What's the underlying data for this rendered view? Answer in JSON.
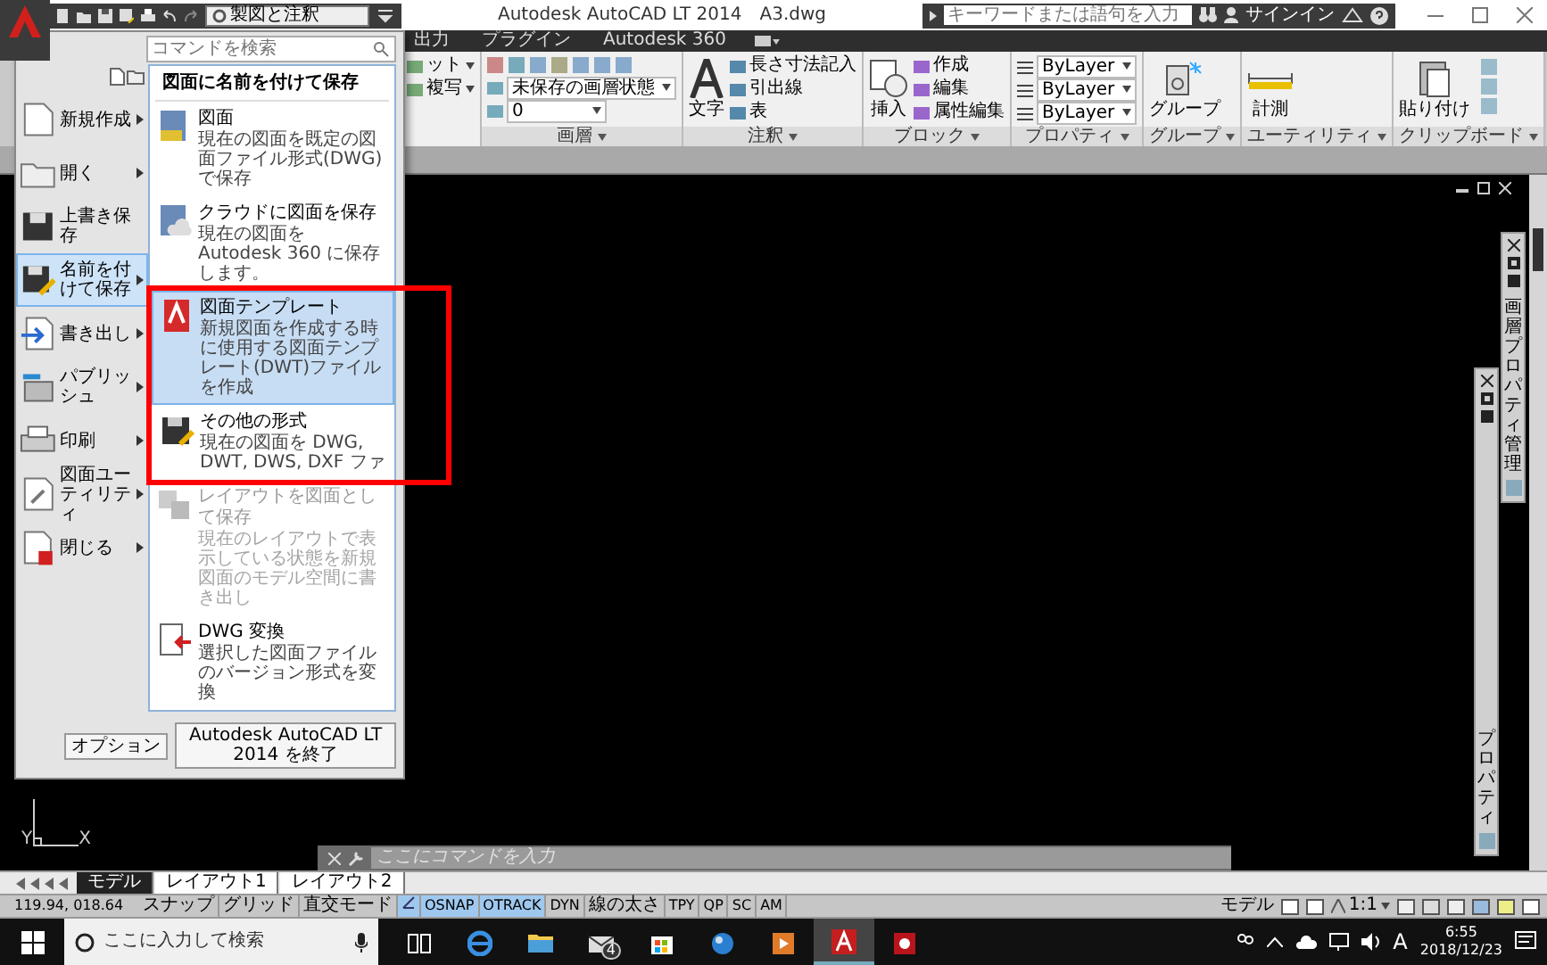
{
  "title_bar": {
    "workspace": "製図と注釈",
    "title": "Autodesk AutoCAD LT 2014",
    "file": "A3.dwg",
    "search": {
      "placeholder": "キーワードまたは語句を入力"
    },
    "sign_in": "サインイン"
  },
  "ribbon_tabs": [
    {
      "label": "出力",
      "selected": false
    },
    {
      "label": "プラグイン",
      "selected": false
    },
    {
      "label": "Autodesk 360",
      "selected": false
    }
  ],
  "ribbon_panels": [
    {
      "kind": "partial",
      "rows": [
        {
          "kind": "button",
          "label": "ット"
        },
        {
          "kind": "button",
          "label": "複写"
        }
      ]
    },
    {
      "kind": "layer",
      "title": "画層",
      "rows": [
        {
          "kind": "dropdown",
          "label": "未保存の画層状態"
        },
        {
          "kind": "dropdown",
          "label": "0"
        }
      ]
    },
    {
      "kind": "annotation",
      "title": "注釈",
      "large": "文字",
      "rows": [
        {
          "kind": "button",
          "label": "長さ寸法記入"
        },
        {
          "kind": "button",
          "label": "引出線"
        },
        {
          "kind": "button",
          "label": "表"
        }
      ]
    },
    {
      "kind": "block",
      "title": "ブロック",
      "large": "挿入",
      "rows": [
        {
          "kind": "button",
          "label": "作成"
        },
        {
          "kind": "button",
          "label": "編集"
        },
        {
          "kind": "button",
          "label": "属性編集"
        }
      ]
    },
    {
      "kind": "properties",
      "title": "プロパティ",
      "rows": [
        {
          "kind": "dropdown",
          "label": "ByLayer"
        },
        {
          "kind": "dropdown",
          "label": "ByLayer"
        },
        {
          "kind": "dropdown",
          "label": "ByLayer"
        }
      ]
    },
    {
      "kind": "group",
      "title": "グループ",
      "large": "グループ"
    },
    {
      "kind": "utilities",
      "title": "ユーティリティ",
      "large": "計測"
    },
    {
      "kind": "clipboard",
      "title": "クリップボード",
      "large": "貼り付け"
    }
  ],
  "app_menu": {
    "search": {
      "placeholder": "コマンドを検索"
    },
    "left_items": [
      {
        "kind": "new",
        "label": "新規作成",
        "submenu": true,
        "selected": false
      },
      {
        "kind": "open",
        "label": "開く",
        "submenu": true,
        "selected": false
      },
      {
        "kind": "save",
        "label": "上書き保存",
        "submenu": false,
        "selected": false
      },
      {
        "kind": "saveas",
        "label": "名前を付けて保存",
        "submenu": true,
        "selected": true
      },
      {
        "kind": "export",
        "label": "書き出し",
        "submenu": true,
        "selected": false
      },
      {
        "kind": "publish",
        "label": "パブリッシュ",
        "submenu": true,
        "selected": false
      },
      {
        "kind": "print",
        "label": "印刷",
        "submenu": true,
        "selected": false
      },
      {
        "kind": "utilities",
        "label": "図面ユーティリティ",
        "submenu": true,
        "selected": false
      },
      {
        "kind": "close",
        "label": "閉じる",
        "submenu": true,
        "selected": false
      }
    ],
    "panel_title": "図面に名前を付けて保存",
    "panel_items": [
      {
        "kind": "drawing",
        "title": "図面",
        "description": "現在の図面を既定の図面ファイル形式(DWG)で保存",
        "selected": false,
        "disabled": false,
        "framed": false
      },
      {
        "kind": "cloud",
        "title": "クラウドに図面を保存",
        "description": "現在の図面を Autodesk 360 に保存します。",
        "selected": false,
        "disabled": false,
        "framed": false
      },
      {
        "kind": "template",
        "title": "図面テンプレート",
        "description": "新規図面を作成する時に使用する図面テンプレート(DWT)ファイルを作成",
        "selected": true,
        "disabled": false,
        "framed": true
      },
      {
        "kind": "other",
        "title": "その他の形式",
        "description": "現在の図面を DWG, DWT, DWS, DXF ファ",
        "selected": false,
        "disabled": false,
        "framed": true
      },
      {
        "kind": "layout",
        "title": "レイアウトを図面として保存",
        "description": "現在のレイアウトで表示している状態を新規図面のモデル空間に書き出し",
        "selected": false,
        "disabled": true,
        "framed": false
      },
      {
        "kind": "convert",
        "title": "DWG 変換",
        "description": "選択した図面ファイルのバージョン形式を変換",
        "selected": false,
        "disabled": false,
        "framed": false
      }
    ],
    "buttons": [
      "オプション",
      "Autodesk AutoCAD LT 2014 を終了"
    ]
  },
  "drawing": {
    "ucs": {
      "x": "X",
      "y": "Y"
    },
    "palettes": [
      {
        "title": "画層プロパティ管理"
      },
      {
        "title": "プロパティ"
      }
    ],
    "command_line": {
      "placeholder": "ここにコマンドを入力"
    }
  },
  "layout_tabs": [
    {
      "label": "モデル",
      "selected": true
    },
    {
      "label": "レイアウト1",
      "selected": false
    },
    {
      "label": "レイアウト2",
      "selected": false
    }
  ],
  "status_bar": {
    "coordinates": "119.94, 018.64",
    "toggles": [
      {
        "kind": "text",
        "label": "スナップ",
        "on": false
      },
      {
        "kind": "text",
        "label": "グリッド",
        "on": false
      },
      {
        "kind": "text",
        "label": "直交モード",
        "on": false
      },
      {
        "kind": "icon",
        "on": true
      },
      {
        "kind": "text",
        "label": "OSNAP",
        "on": true
      },
      {
        "kind": "text",
        "label": "OTRACK",
        "on": true
      },
      {
        "kind": "text",
        "label": "DYN",
        "on": false
      },
      {
        "kind": "text",
        "label": "線の太さ",
        "on": false
      },
      {
        "kind": "text",
        "label": "TPY",
        "on": false
      },
      {
        "kind": "text",
        "label": "QP",
        "on": false
      },
      {
        "kind": "text",
        "label": "SC",
        "on": false
      },
      {
        "kind": "text",
        "label": "AM",
        "on": false
      }
    ],
    "space": "モデル",
    "scale": "1:1"
  },
  "taskbar": {
    "search": {
      "placeholder": "ここに入力して検索"
    },
    "apps": [
      {
        "kind": "taskview",
        "selected": false
      },
      {
        "kind": "browser",
        "selected": false
      },
      {
        "kind": "folder",
        "selected": false
      },
      {
        "kind": "mail",
        "selected": false,
        "badge": "4"
      },
      {
        "kind": "store",
        "selected": false
      },
      {
        "kind": "globe",
        "selected": false
      },
      {
        "kind": "media",
        "selected": false
      },
      {
        "kind": "cad",
        "selected": true
      },
      {
        "kind": "redapp",
        "selected": false
      }
    ],
    "ime": "A",
    "time": "6:55",
    "date": "2018/12/23"
  }
}
